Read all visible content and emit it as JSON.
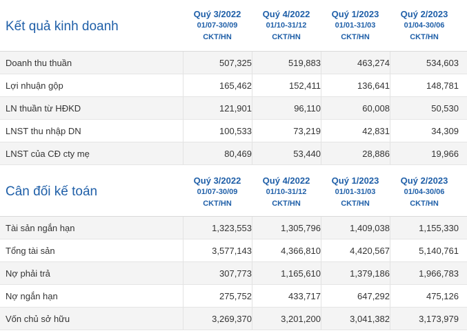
{
  "business": {
    "title": "Kết quả kinh doanh",
    "periods": [
      {
        "quarter": "Quý 3/2022",
        "dates": "01/07-30/09",
        "type": "CKT/HN"
      },
      {
        "quarter": "Quý 4/2022",
        "dates": "01/10-31/12",
        "type": "CKT/HN"
      },
      {
        "quarter": "Quý 1/2023",
        "dates": "01/01-31/03",
        "type": "CKT/HN"
      },
      {
        "quarter": "Quý 2/2023",
        "dates": "01/04-30/06",
        "type": "CKT/HN"
      }
    ],
    "rows": [
      {
        "label": "Doanh thu thuần",
        "values": [
          "507,325",
          "519,883",
          "463,274",
          "534,603"
        ]
      },
      {
        "label": "Lợi nhuận gộp",
        "values": [
          "165,462",
          "152,411",
          "136,641",
          "148,781"
        ]
      },
      {
        "label": "LN thuần từ HĐKD",
        "values": [
          "121,901",
          "96,110",
          "60,008",
          "50,530"
        ]
      },
      {
        "label": "LNST thu nhập DN",
        "values": [
          "100,533",
          "73,219",
          "42,831",
          "34,309"
        ]
      },
      {
        "label": "LNST của CĐ cty mẹ",
        "values": [
          "80,469",
          "53,440",
          "28,886",
          "19,966"
        ]
      }
    ]
  },
  "balance": {
    "title": "Cân đối kế toán",
    "periods": [
      {
        "quarter": "Quý 3/2022",
        "dates": "01/07-30/09",
        "type": "CKT/HN"
      },
      {
        "quarter": "Quý 4/2022",
        "dates": "01/10-31/12",
        "type": "CKT/HN"
      },
      {
        "quarter": "Quý 1/2023",
        "dates": "01/01-31/03",
        "type": "CKT/HN"
      },
      {
        "quarter": "Quý 2/2023",
        "dates": "01/04-30/06",
        "type": "CKT/HN"
      }
    ],
    "rows": [
      {
        "label": "Tài sản ngắn hạn",
        "values": [
          "1,323,553",
          "1,305,796",
          "1,409,038",
          "1,155,330"
        ]
      },
      {
        "label": "Tổng tài sản",
        "values": [
          "3,577,143",
          "4,366,810",
          "4,420,567",
          "5,140,761"
        ]
      },
      {
        "label": "Nợ phải trả",
        "values": [
          "307,773",
          "1,165,610",
          "1,379,186",
          "1,966,783"
        ]
      },
      {
        "label": "Nợ ngắn hạn",
        "values": [
          "275,752",
          "433,717",
          "647,292",
          "475,126"
        ]
      },
      {
        "label": "Vốn chủ sở hữu",
        "values": [
          "3,269,370",
          "3,201,200",
          "3,041,382",
          "3,173,979"
        ]
      }
    ]
  }
}
